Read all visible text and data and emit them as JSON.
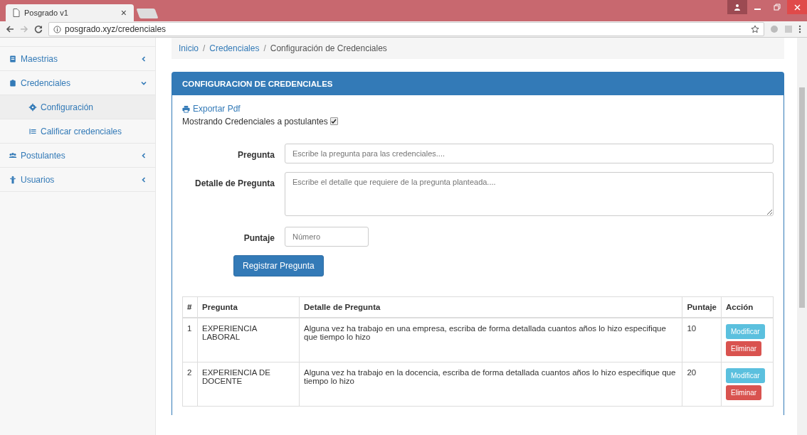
{
  "browser": {
    "tab_title": "Posgrado v1",
    "tab_close": "×",
    "url": "posgrado.xyz/credenciales"
  },
  "sidebar": {
    "items": [
      {
        "label": "Maestrias",
        "expanded": false
      },
      {
        "label": "Credenciales",
        "expanded": true,
        "children": [
          {
            "label": "Configuración",
            "selected": true
          },
          {
            "label": "Calificar credenciales",
            "selected": false
          }
        ]
      },
      {
        "label": "Postulantes",
        "expanded": false
      },
      {
        "label": "Usuarios",
        "expanded": false
      }
    ]
  },
  "breadcrumb": [
    {
      "kind": "link",
      "label": "Inicio"
    },
    {
      "kind": "separator",
      "label": "/"
    },
    {
      "kind": "link",
      "label": "Credenciales"
    },
    {
      "kind": "separator",
      "label": "/"
    },
    {
      "kind": "current",
      "label": "Configuración de Credenciales"
    }
  ],
  "panel": {
    "title": "CONFIGURACION DE CREDENCIALES",
    "export_link": "Exportar Pdf",
    "show_label": "Mostrando Credenciales a postulantes",
    "show_checked": true,
    "form": [
      {
        "kind": "text",
        "label": "Pregunta",
        "placeholder": "Escribe la pregunta para las credenciales...."
      },
      {
        "kind": "textarea",
        "label": "Detalle de Pregunta",
        "placeholder": "Escribe el detalle que requiere de la pregunta planteada...."
      },
      {
        "kind": "number",
        "label": "Puntaje",
        "placeholder": "Número"
      }
    ],
    "submit": "Registrar Pregunta"
  },
  "table": {
    "columns": [
      "#",
      "Pregunta",
      "Detalle de Pregunta",
      "Puntaje",
      "Acción"
    ],
    "rows": [
      {
        "cells": [
          "1",
          "EXPERIENCIA LABORAL",
          "Alguna vez ha trabajo en una empresa, escriba de forma detallada cuantos años lo hizo especifique que tiempo lo hizo",
          "10"
        ],
        "actions": [
          "Modificar",
          "Eliminar"
        ]
      },
      {
        "cells": [
          "2",
          "EXPERIENCIA DE DOCENTE",
          "Alguna vez ha trabajo en la docencia, escriba de forma detallada cuantos años lo hizo especifique que tiempo lo hizo",
          "20"
        ],
        "actions": [
          "Modificar",
          "Eliminar"
        ]
      }
    ]
  }
}
